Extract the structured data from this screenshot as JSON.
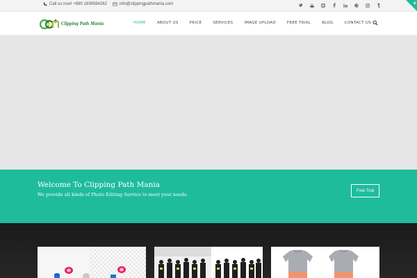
{
  "topbar": {
    "phone": "Call us now! +880 1836564262",
    "email": "info@clippingpathmania.com",
    "social_icons": [
      "twitter-icon",
      "youtube-icon",
      "linkedin-square-icon",
      "facebook-icon",
      "linkedin-icon",
      "pinterest-icon",
      "instagram-icon",
      "tumblr-icon"
    ]
  },
  "header": {
    "logo_text": "Clipping Path Mania",
    "nav": [
      "HOME",
      "ABOUT US",
      "PRICE",
      "SERVICES",
      "IMAGE UPLOAD",
      "FREE TRIAL",
      "BLOG",
      "CONTACT US"
    ],
    "active_nav": "HOME"
  },
  "welcome": {
    "title": "Welcome To Clipping Path Mania",
    "subtitle": "We provide all kinds of Photo Editing Service to meet your needs.",
    "button": "Free Trial"
  },
  "colors": {
    "accent": "#1fbc9c",
    "topbar_bg": "#f3f3f3",
    "hero_bg": "#e6e6e6",
    "dark_bg": "#1b1b1b"
  }
}
